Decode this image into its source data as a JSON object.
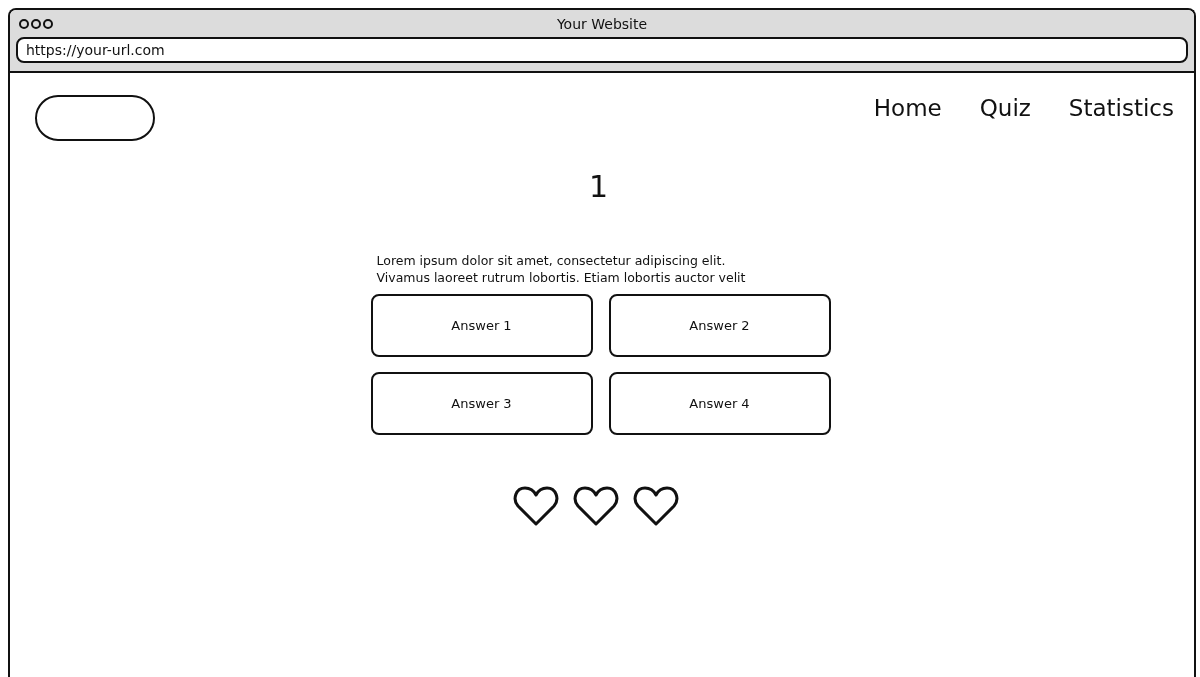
{
  "window": {
    "title": "Your Website",
    "address": "https://your-url.com"
  },
  "nav": [
    {
      "label": "Home"
    },
    {
      "label": "Quiz"
    },
    {
      "label": "Statistics"
    }
  ],
  "question_number": "1",
  "question": "Lorem ipsum dolor sit amet, consectetur adipiscing elit.\nVivamus laoreet rutrum lobortis. Etiam lobortis auctor velit",
  "answers": [
    {
      "label": "Answer 1"
    },
    {
      "label": "Answer 2"
    },
    {
      "label": "Answer 3"
    },
    {
      "label": "Answer 4"
    }
  ],
  "lives": [
    {
      "kind": "heart"
    },
    {
      "kind": "heart"
    },
    {
      "kind": "heart"
    }
  ]
}
